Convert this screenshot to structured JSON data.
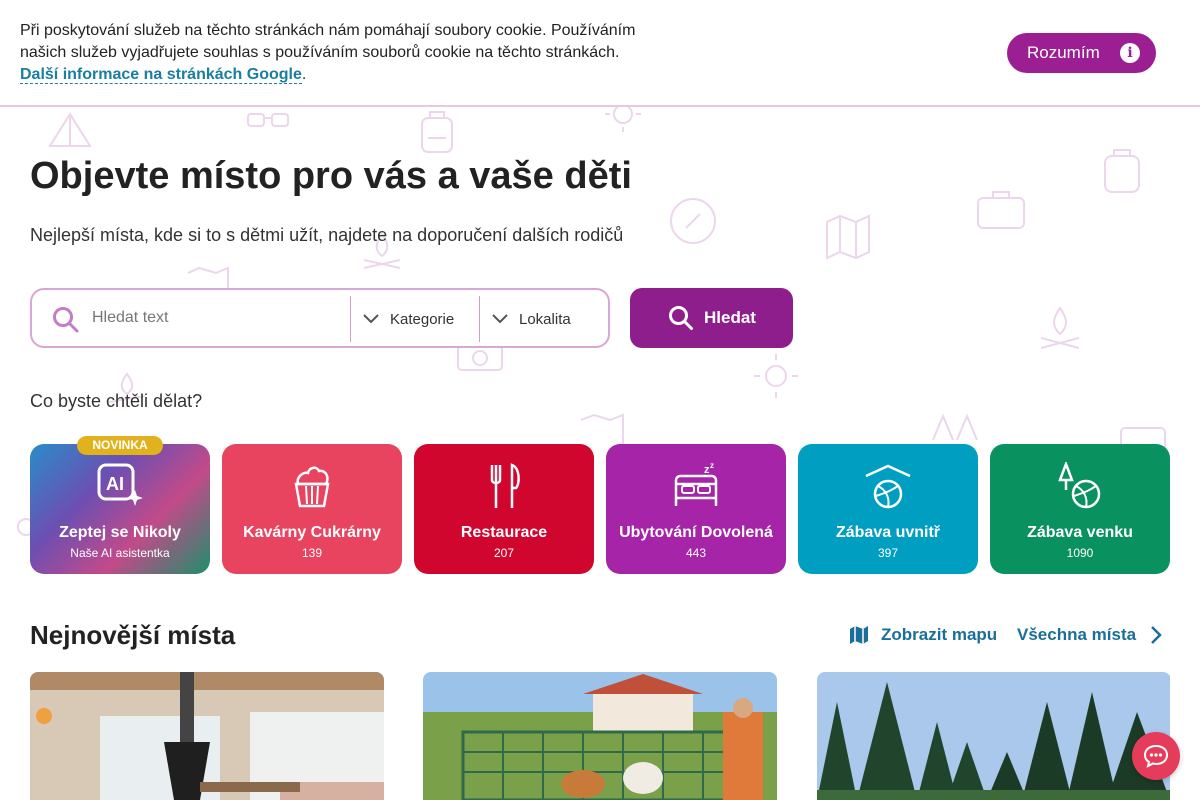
{
  "cookie": {
    "text": "Při poskytování služeb na těchto stránkách nám pomáhají soubory cookie. Používáním našich služeb vyjadřujete souhlas s používáním souborů cookie na těchto stránkách. ",
    "link": "Další informace na stránkách Google",
    "link_suffix": ".",
    "accept": "Rozumím",
    "info_icon": "info-icon"
  },
  "hero": {
    "title": "Objevte místo pro vás a vaše děti",
    "subtitle": "Nejlepší místa, kde si to s dětmi užít, najdete na doporučení dalších rodičů"
  },
  "search": {
    "placeholder": "Hledat text",
    "category": "Kategorie",
    "location": "Lokalita",
    "button": "Hledat"
  },
  "what_label": "Co byste chtěli dělat?",
  "categories": [
    {
      "title": "Zeptej se Nikoly",
      "count": "Naše AI asistentka",
      "badge": "NOVINKA",
      "icon": "ai-icon"
    },
    {
      "title": "Kavárny Cukrárny",
      "count": "139",
      "icon": "cupcake-icon",
      "color": "#e8435f"
    },
    {
      "title": "Restaurace",
      "count": "207",
      "icon": "fork-knife-icon",
      "color": "#d0062e"
    },
    {
      "title": "Ubytování Dovolená",
      "count": "443",
      "icon": "bed-icon",
      "color": "#a624a8"
    },
    {
      "title": "Zábava uvnitř",
      "count": "397",
      "icon": "indoor-ball-icon",
      "color": "#009ec0"
    },
    {
      "title": "Zábava venku",
      "count": "1090",
      "icon": "outdoor-ball-icon",
      "color": "#0a9160"
    }
  ],
  "newest": {
    "title": "Nejnovější místa",
    "map": "Zobrazit mapu",
    "all": "Všechna místa"
  }
}
